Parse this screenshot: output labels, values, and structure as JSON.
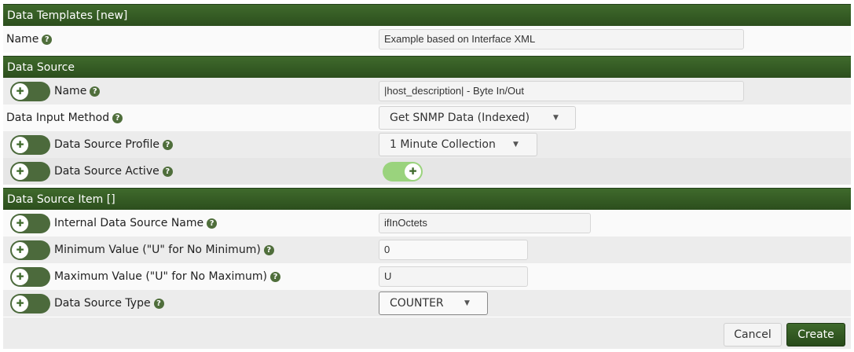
{
  "section_templates": {
    "title": "Data Templates [new]",
    "name": {
      "label": "Name",
      "value": "Example based on Interface XML"
    }
  },
  "section_source": {
    "title": "Data Source",
    "name": {
      "label": "Name",
      "value": "|host_description| - Byte In/Out"
    },
    "input_method": {
      "label": "Data Input Method",
      "value": "Get SNMP Data (Indexed)"
    },
    "profile": {
      "label": "Data Source Profile",
      "value": "1 Minute Collection"
    },
    "active": {
      "label": "Data Source Active",
      "state": "on"
    }
  },
  "section_item": {
    "title": "Data Source Item []",
    "internal_name": {
      "label": "Internal Data Source Name",
      "value": "ifInOctets"
    },
    "min_value": {
      "label": "Minimum Value (\"U\" for No Minimum)",
      "value": "0"
    },
    "max_value": {
      "label": "Maximum Value (\"U\" for No Maximum)",
      "value": "U"
    },
    "ds_type": {
      "label": "Data Source Type",
      "value": "COUNTER"
    }
  },
  "footer": {
    "cancel_label": "Cancel",
    "create_label": "Create"
  },
  "icons": {
    "help": "?",
    "toggle_knob": "✚",
    "caret": "▼"
  },
  "colors": {
    "header_green": "#2c4e1d",
    "toggle_off": "#4c6a3c",
    "toggle_on": "#9ad37d"
  }
}
